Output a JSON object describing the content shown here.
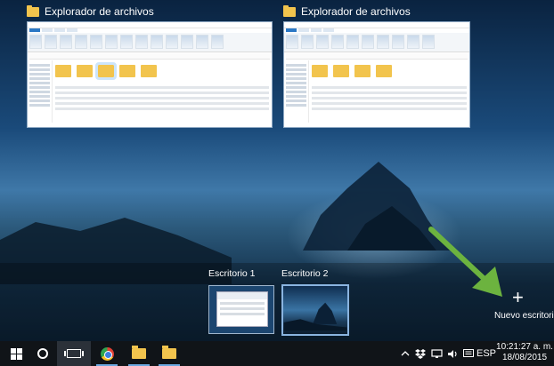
{
  "windows": [
    {
      "title": "Explorador de archivos",
      "icon": "folder-icon"
    },
    {
      "title": "Explorador de archivos",
      "icon": "folder-icon"
    }
  ],
  "desktops": [
    {
      "label": "Escritorio 1"
    },
    {
      "label": "Escritorio 2"
    }
  ],
  "new_desktop": {
    "label": "Nuevo escritorio",
    "icon": "+"
  },
  "taskbar": {
    "language": "ESP",
    "clock_time": "10:21:27 a. m.",
    "clock_date": "18/08/2015",
    "items": [
      "start-button-icon",
      "cortana-icon",
      "task-view-icon",
      "chrome-icon",
      "file-explorer-icon",
      "file-explorer-icon"
    ]
  },
  "colors": {
    "accent": "#6aa8e0",
    "arrow": "#6cb33f",
    "folder": "#f2c44d"
  }
}
